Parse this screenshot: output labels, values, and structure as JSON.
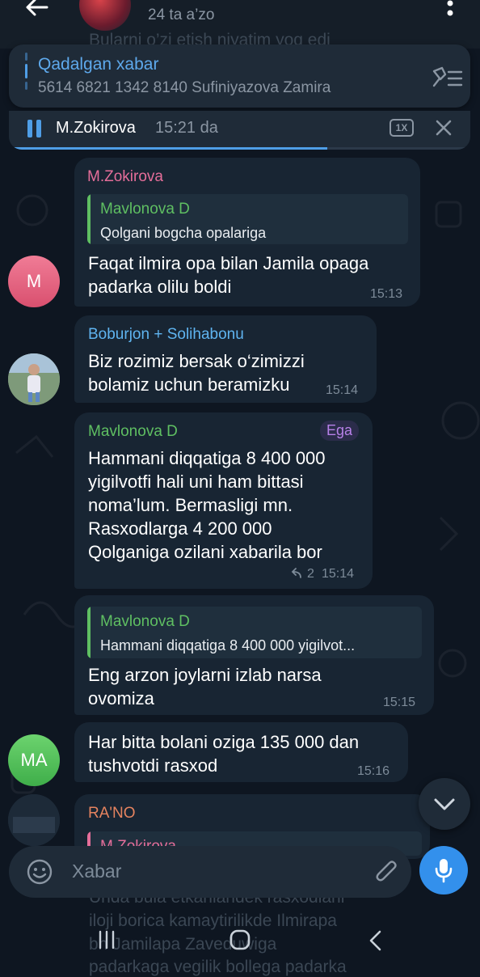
{
  "header": {
    "members": "24 ta a’zo",
    "ghost_text": "Bularni o’zi etish niyatim yoq edi"
  },
  "pinned": {
    "title": "Qadalgan xabar",
    "text": "5614 6821 1342 8140 Sufiniyazova Zamira"
  },
  "player": {
    "name": "M.Zokirova",
    "time": "15:21 da",
    "speed": "1X",
    "progress": 0.69
  },
  "messages": [
    {
      "sender": "M.Zokirova",
      "avatar_initial": "M",
      "reply_name": "Mavlonova D",
      "reply_text": "Qolgani bogcha opalariga",
      "lines": [
        "Faqat ilmira opa bilan Jamila opaga",
        "padarka olilu boldi"
      ],
      "time": "15:13"
    },
    {
      "sender": "Boburjon + Solihabonu",
      "lines": [
        "Biz rozimiz bersak o‘zimizzi",
        "bolamiz uchun beramizku"
      ],
      "time": "15:14"
    },
    {
      "sender": "Mavlonova D",
      "badge": "Ega",
      "lines": [
        "Hammani diqqatiga 8 400 000",
        "yigilvotfi hali uni ham bittasi",
        "noma’lum. Bermasligi mn.",
        "Rasxodlarga 4 200 000",
        "Qolganiga ozilani xabarila bor"
      ],
      "forwards": "2",
      "time": "15:14"
    },
    {
      "reply_name": "Mavlonova D",
      "reply_text": "Hammani diqqatiga 8 400 000 yigilvot...",
      "lines": [
        "Eng arzon joylarni izlab narsa",
        "ovomiza"
      ],
      "time": "15:15"
    },
    {
      "avatar_initial": "MA",
      "lines": [
        "Har bitta bolani oziga 135 000 dan",
        "tushvotdi rasxod"
      ],
      "time": "15:16"
    },
    {
      "sender": "RA'NO",
      "reply_name": "M.Zokirova"
    }
  ],
  "input": {
    "placeholder": "Xabar"
  },
  "under_text": [
    "Unda bula etkanlandek rasxodlani",
    "iloji borica kamaytirilikde Ilmirapa",
    "bn Jamilapa Zaveduwiga",
    "padarkaga vegilik bollega padarka"
  ],
  "colors": {
    "background": "#0e1621",
    "bubble": "#182533",
    "accent": "#3390ec",
    "name_pink": "#e56e9a",
    "name_blue": "#5fb4f0",
    "name_green": "#5fbf62",
    "name_orange": "#e5835f"
  },
  "icons": [
    "back-arrow-icon",
    "more-vertical-icon",
    "unpin-icon",
    "pause-icon",
    "close-icon",
    "chevron-down-icon",
    "emoji-icon",
    "attach-icon",
    "microphone-icon",
    "forward-icon"
  ]
}
